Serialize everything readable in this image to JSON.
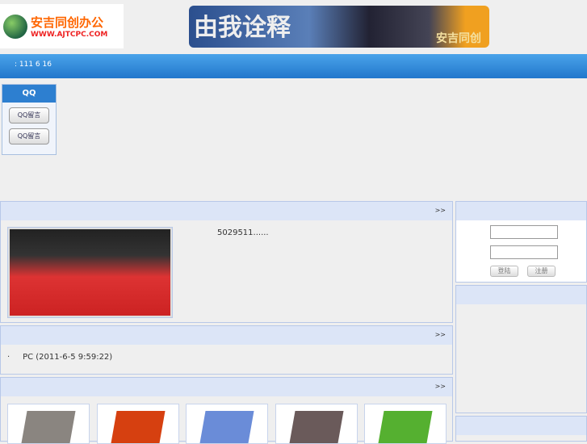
{
  "header": {
    "logo_cn": "安吉同创办公",
    "logo_url": "WWW.AJTCPC.COM",
    "banner_text": "由我诠释",
    "banner_sub": "安吉同创"
  },
  "nav": {
    "date_text": ": 111 6 16"
  },
  "qq": {
    "title": "QQ",
    "buttons": [
      "QQ留言",
      "QQ留言"
    ]
  },
  "news": {
    "more": ">>",
    "summary": "5029511......"
  },
  "list": {
    "more": ">>",
    "items": [
      {
        "text": "PC (2011-6-5 9:59:22)"
      }
    ]
  },
  "products": {
    "more": ">>",
    "colors": [
      "#8a8580",
      "#d64010",
      "#6a8cd8",
      "#6a5a5a",
      "#55b030"
    ]
  },
  "login": {
    "login_btn": "登陆",
    "register_btn": "注册"
  }
}
